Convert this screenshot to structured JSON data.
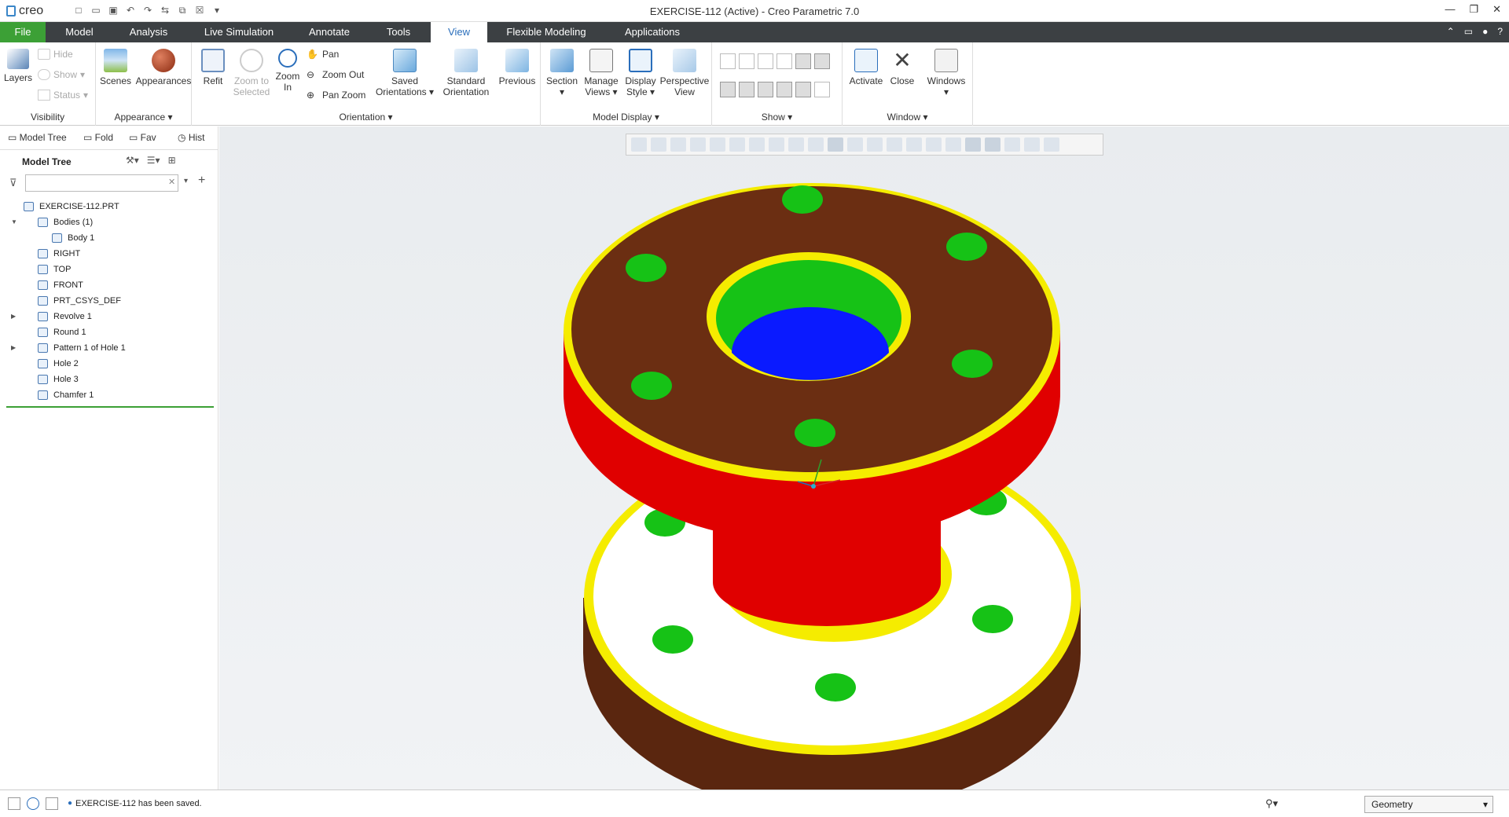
{
  "window": {
    "app_logo": "creo",
    "title": "EXERCISE-112 (Active) - Creo Parametric 7.0",
    "controls": [
      "minimize-icon",
      "restore-icon",
      "close-icon"
    ]
  },
  "menubar": {
    "tabs": [
      {
        "label": "File"
      },
      {
        "label": "Model"
      },
      {
        "label": "Analysis"
      },
      {
        "label": "Live Simulation"
      },
      {
        "label": "Annotate"
      },
      {
        "label": "Tools"
      },
      {
        "label": "View"
      },
      {
        "label": "Flexible Modeling"
      },
      {
        "label": "Applications"
      }
    ],
    "active_tab": "View"
  },
  "ribbon": {
    "visibility": {
      "group_label": "Visibility",
      "layers": "Layers",
      "hide": "Hide",
      "show": "Show",
      "status": "Status"
    },
    "appearance": {
      "group_label": "Appearance",
      "scenes": "Scenes",
      "appearances": "Appearances"
    },
    "orientation": {
      "group_label": "Orientation",
      "refit": "Refit",
      "zoom_to_selected_1": "Zoom to",
      "zoom_to_selected_2": "Selected",
      "zoom_in_1": "Zoom",
      "zoom_in_2": "In",
      "pan": "Pan",
      "zoom_out": "Zoom Out",
      "pan_zoom": "Pan Zoom",
      "saved_orientations_1": "Saved",
      "saved_orientations_2": "Orientations",
      "standard_orientation_1": "Standard",
      "standard_orientation_2": "Orientation",
      "previous": "Previous"
    },
    "model_display": {
      "group_label": "Model Display",
      "section": "Section",
      "manage_views_1": "Manage",
      "manage_views_2": "Views",
      "display_style_1": "Display",
      "display_style_2": "Style",
      "perspective_view_1": "Perspective",
      "perspective_view_2": "View"
    },
    "show": {
      "group_label": "Show"
    },
    "window": {
      "group_label": "Window",
      "activate": "Activate",
      "close": "Close",
      "windows": "Windows"
    }
  },
  "left_panel": {
    "tabs": [
      "Model Tree",
      "Fold",
      "Fav",
      "Hist"
    ],
    "header": "Model Tree",
    "search_placeholder": "",
    "tree": [
      {
        "label": "EXERCISE-112.PRT",
        "level": 0,
        "expander": ""
      },
      {
        "label": "Bodies (1)",
        "level": 1,
        "expander": "▼"
      },
      {
        "label": "Body 1",
        "level": 2,
        "expander": ""
      },
      {
        "label": "RIGHT",
        "level": 1,
        "expander": ""
      },
      {
        "label": "TOP",
        "level": 1,
        "expander": ""
      },
      {
        "label": "FRONT",
        "level": 1,
        "expander": ""
      },
      {
        "label": "PRT_CSYS_DEF",
        "level": 1,
        "expander": ""
      },
      {
        "label": "Revolve 1",
        "level": 1,
        "expander": "▶"
      },
      {
        "label": "Round 1",
        "level": 1,
        "expander": ""
      },
      {
        "label": "Pattern 1 of Hole 1",
        "level": 1,
        "expander": "▶"
      },
      {
        "label": "Hole 2",
        "level": 1,
        "expander": ""
      },
      {
        "label": "Hole 3",
        "level": 1,
        "expander": ""
      },
      {
        "label": "Chamfer 1",
        "level": 1,
        "expander": ""
      }
    ]
  },
  "colors": {
    "file_tab": "#3ca036",
    "menubar_bg": "#3c4043",
    "part_top": "#6b2e12",
    "part_body": "#e00000",
    "part_edge": "#f5ec00",
    "holes": "#16c216",
    "bore_bottom": "#0a1aff",
    "lower_face": "#ffffff"
  },
  "status_bar": {
    "message": "EXERCISE-112 has been saved.",
    "filter_value": "Geometry"
  }
}
